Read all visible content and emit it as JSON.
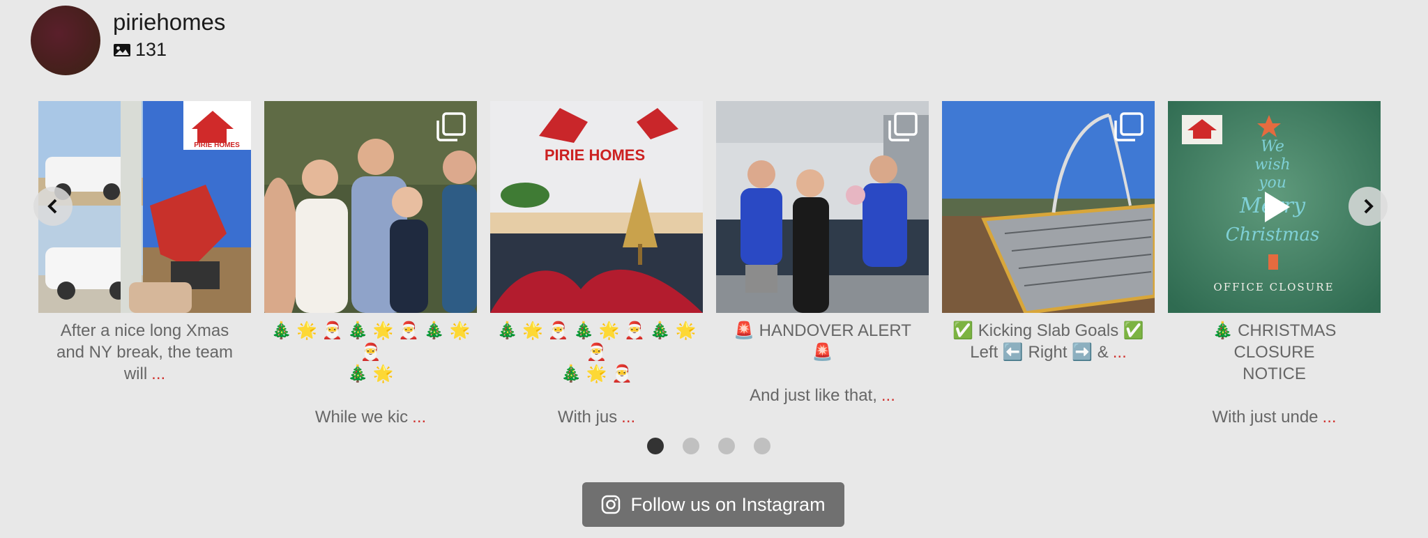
{
  "profile": {
    "username": "piriehomes",
    "post_count": "131",
    "avatar_color": "#4a1f22"
  },
  "posts": [
    {
      "lines": [
        "After a nice long Xmas",
        "and NY break, the team",
        "will"
      ],
      "more": "...",
      "type": "single",
      "icon": "image"
    },
    {
      "lines": [
        "🎄 🌟 🎅 🎄 🌟 🎅 🎄 🌟 🎅",
        "🎄 🌟",
        "",
        "While we kic"
      ],
      "more": "...",
      "type": "multi",
      "icon": "multi-image-icon"
    },
    {
      "lines": [
        "🎄 🌟 🎅 🎄 🌟 🎅 🎄 🌟 🎅",
        "🎄 🌟 🎅",
        "",
        "With jus"
      ],
      "more": "...",
      "type": "single",
      "icon": "image"
    },
    {
      "lines": [
        "🚨 HANDOVER ALERT 🚨",
        "",
        "And just like that,"
      ],
      "more": "...",
      "type": "multi",
      "icon": "multi-image-icon"
    },
    {
      "lines": [
        "✅ Kicking Slab Goals ✅",
        "Left ⬅️ Right ➡️ &"
      ],
      "more": "...",
      "type": "multi",
      "icon": "multi-image-icon"
    },
    {
      "lines": [
        "🎄 CHRISTMAS CLOSURE",
        "NOTICE",
        "",
        "With just unde"
      ],
      "more": "...",
      "type": "video",
      "icon": "play-icon"
    }
  ],
  "thumb_text": {
    "brand_logo": "PIRIE HOMES",
    "sign_text": "PIRIE HOMES",
    "xmas_line1": "We",
    "xmas_line2": "wish",
    "xmas_line3": "you",
    "xmas_line4": "Merry",
    "xmas_line5": "Christmas",
    "office_closure": "OFFICE CLOSURE"
  },
  "pagination": {
    "total": 4,
    "active": 0
  },
  "follow_button": {
    "label": "Follow us on Instagram",
    "icon": "instagram-icon"
  },
  "colors": {
    "more_link": "#d0312d",
    "button_bg": "#707070",
    "page_bg": "#e8e8e8"
  }
}
